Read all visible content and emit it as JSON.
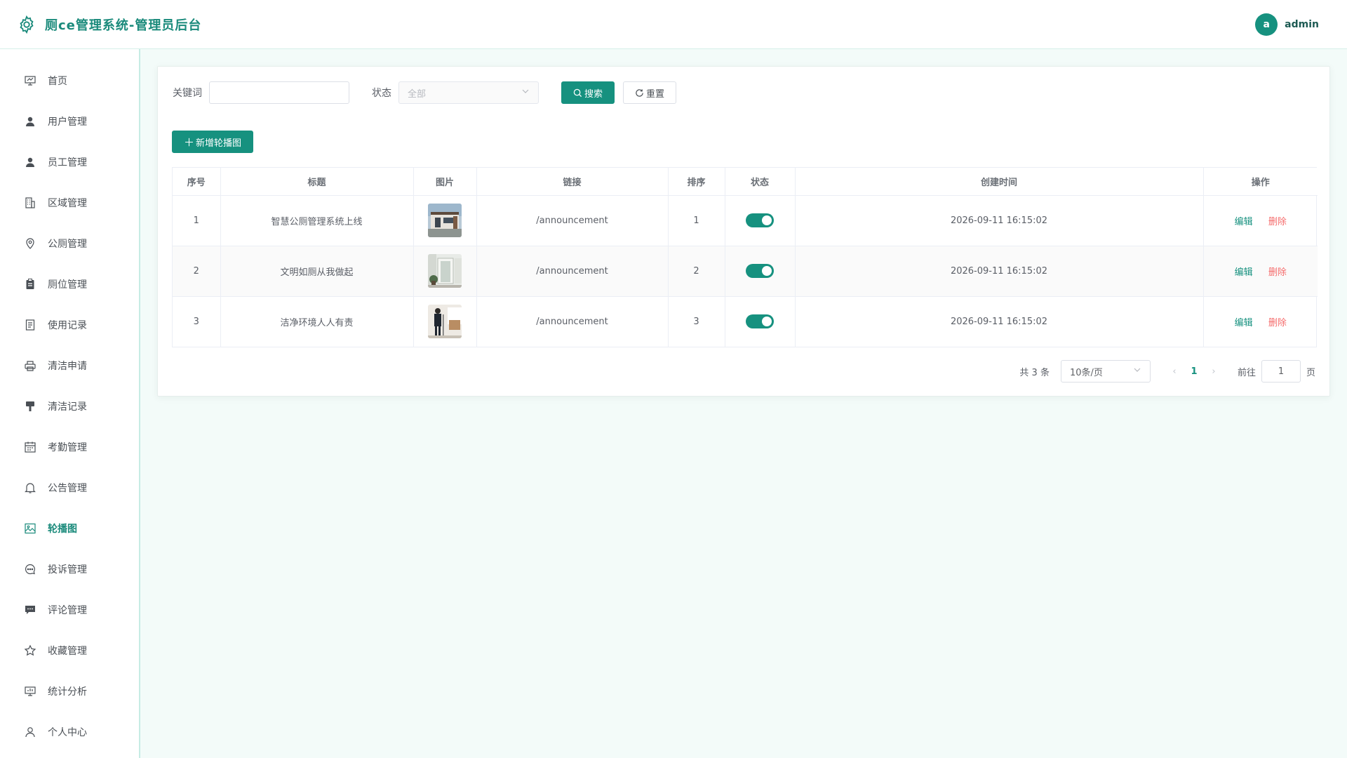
{
  "app": {
    "title": "厕ce管理系统-管理员后台",
    "user": {
      "avatar_letter": "a",
      "name": "admin"
    },
    "accent": "#16917f"
  },
  "sidebar": {
    "items": [
      {
        "label": "首页",
        "icon": "presentation-icon",
        "active": false
      },
      {
        "label": "用户管理",
        "icon": "user-icon",
        "active": false
      },
      {
        "label": "员工管理",
        "icon": "user-icon",
        "active": false
      },
      {
        "label": "区域管理",
        "icon": "office-building-icon",
        "active": false
      },
      {
        "label": "公厕管理",
        "icon": "location-pin-icon",
        "active": false
      },
      {
        "label": "厕位管理",
        "icon": "clipboard-icon",
        "active": false
      },
      {
        "label": "使用记录",
        "icon": "document-icon",
        "active": false
      },
      {
        "label": "清洁申请",
        "icon": "printer-icon",
        "active": false
      },
      {
        "label": "清洁记录",
        "icon": "brush-icon",
        "active": false
      },
      {
        "label": "考勤管理",
        "icon": "calendar-icon",
        "active": false
      },
      {
        "label": "公告管理",
        "icon": "bell-icon",
        "active": false
      },
      {
        "label": "轮播图",
        "icon": "picture-icon",
        "active": true
      },
      {
        "label": "投诉管理",
        "icon": "chat-dots-icon",
        "active": false
      },
      {
        "label": "评论管理",
        "icon": "comment-icon",
        "active": false
      },
      {
        "label": "收藏管理",
        "icon": "star-icon",
        "active": false
      },
      {
        "label": "统计分析",
        "icon": "data-board-icon",
        "active": false
      },
      {
        "label": "个人中心",
        "icon": "user-outline-icon",
        "active": false
      }
    ]
  },
  "filters": {
    "keyword_label": "关键词",
    "keyword_value": "",
    "status_label": "状态",
    "status_placeholder": "全部",
    "search_label": "搜索",
    "reset_label": "重置"
  },
  "toolbar": {
    "add_label": "新增轮播图"
  },
  "table": {
    "columns": [
      "序号",
      "标题",
      "图片",
      "链接",
      "排序",
      "状态",
      "创建时间",
      "操作"
    ],
    "rows": [
      {
        "index": "1",
        "title": "智慧公厕管理系统上线",
        "image": "building-exterior",
        "link": "/announcement",
        "sort": "1",
        "enabled": true,
        "created": "2026-09-11 16:15:02"
      },
      {
        "index": "2",
        "title": "文明如厕从我做起",
        "image": "restroom-entrance",
        "link": "/announcement",
        "sort": "2",
        "enabled": true,
        "created": "2026-09-11 16:15:02"
      },
      {
        "index": "3",
        "title": "洁净环境人人有责",
        "image": "cleaning-staff",
        "link": "/announcement",
        "sort": "3",
        "enabled": true,
        "created": "2026-09-11 16:15:02"
      }
    ],
    "edit_label": "编辑",
    "delete_label": "删除"
  },
  "pagination": {
    "total_text": "共 3 条",
    "page_size": "10条/页",
    "current_page": "1",
    "goto_label": "前往",
    "goto_value": "1",
    "page_suffix": "页"
  }
}
